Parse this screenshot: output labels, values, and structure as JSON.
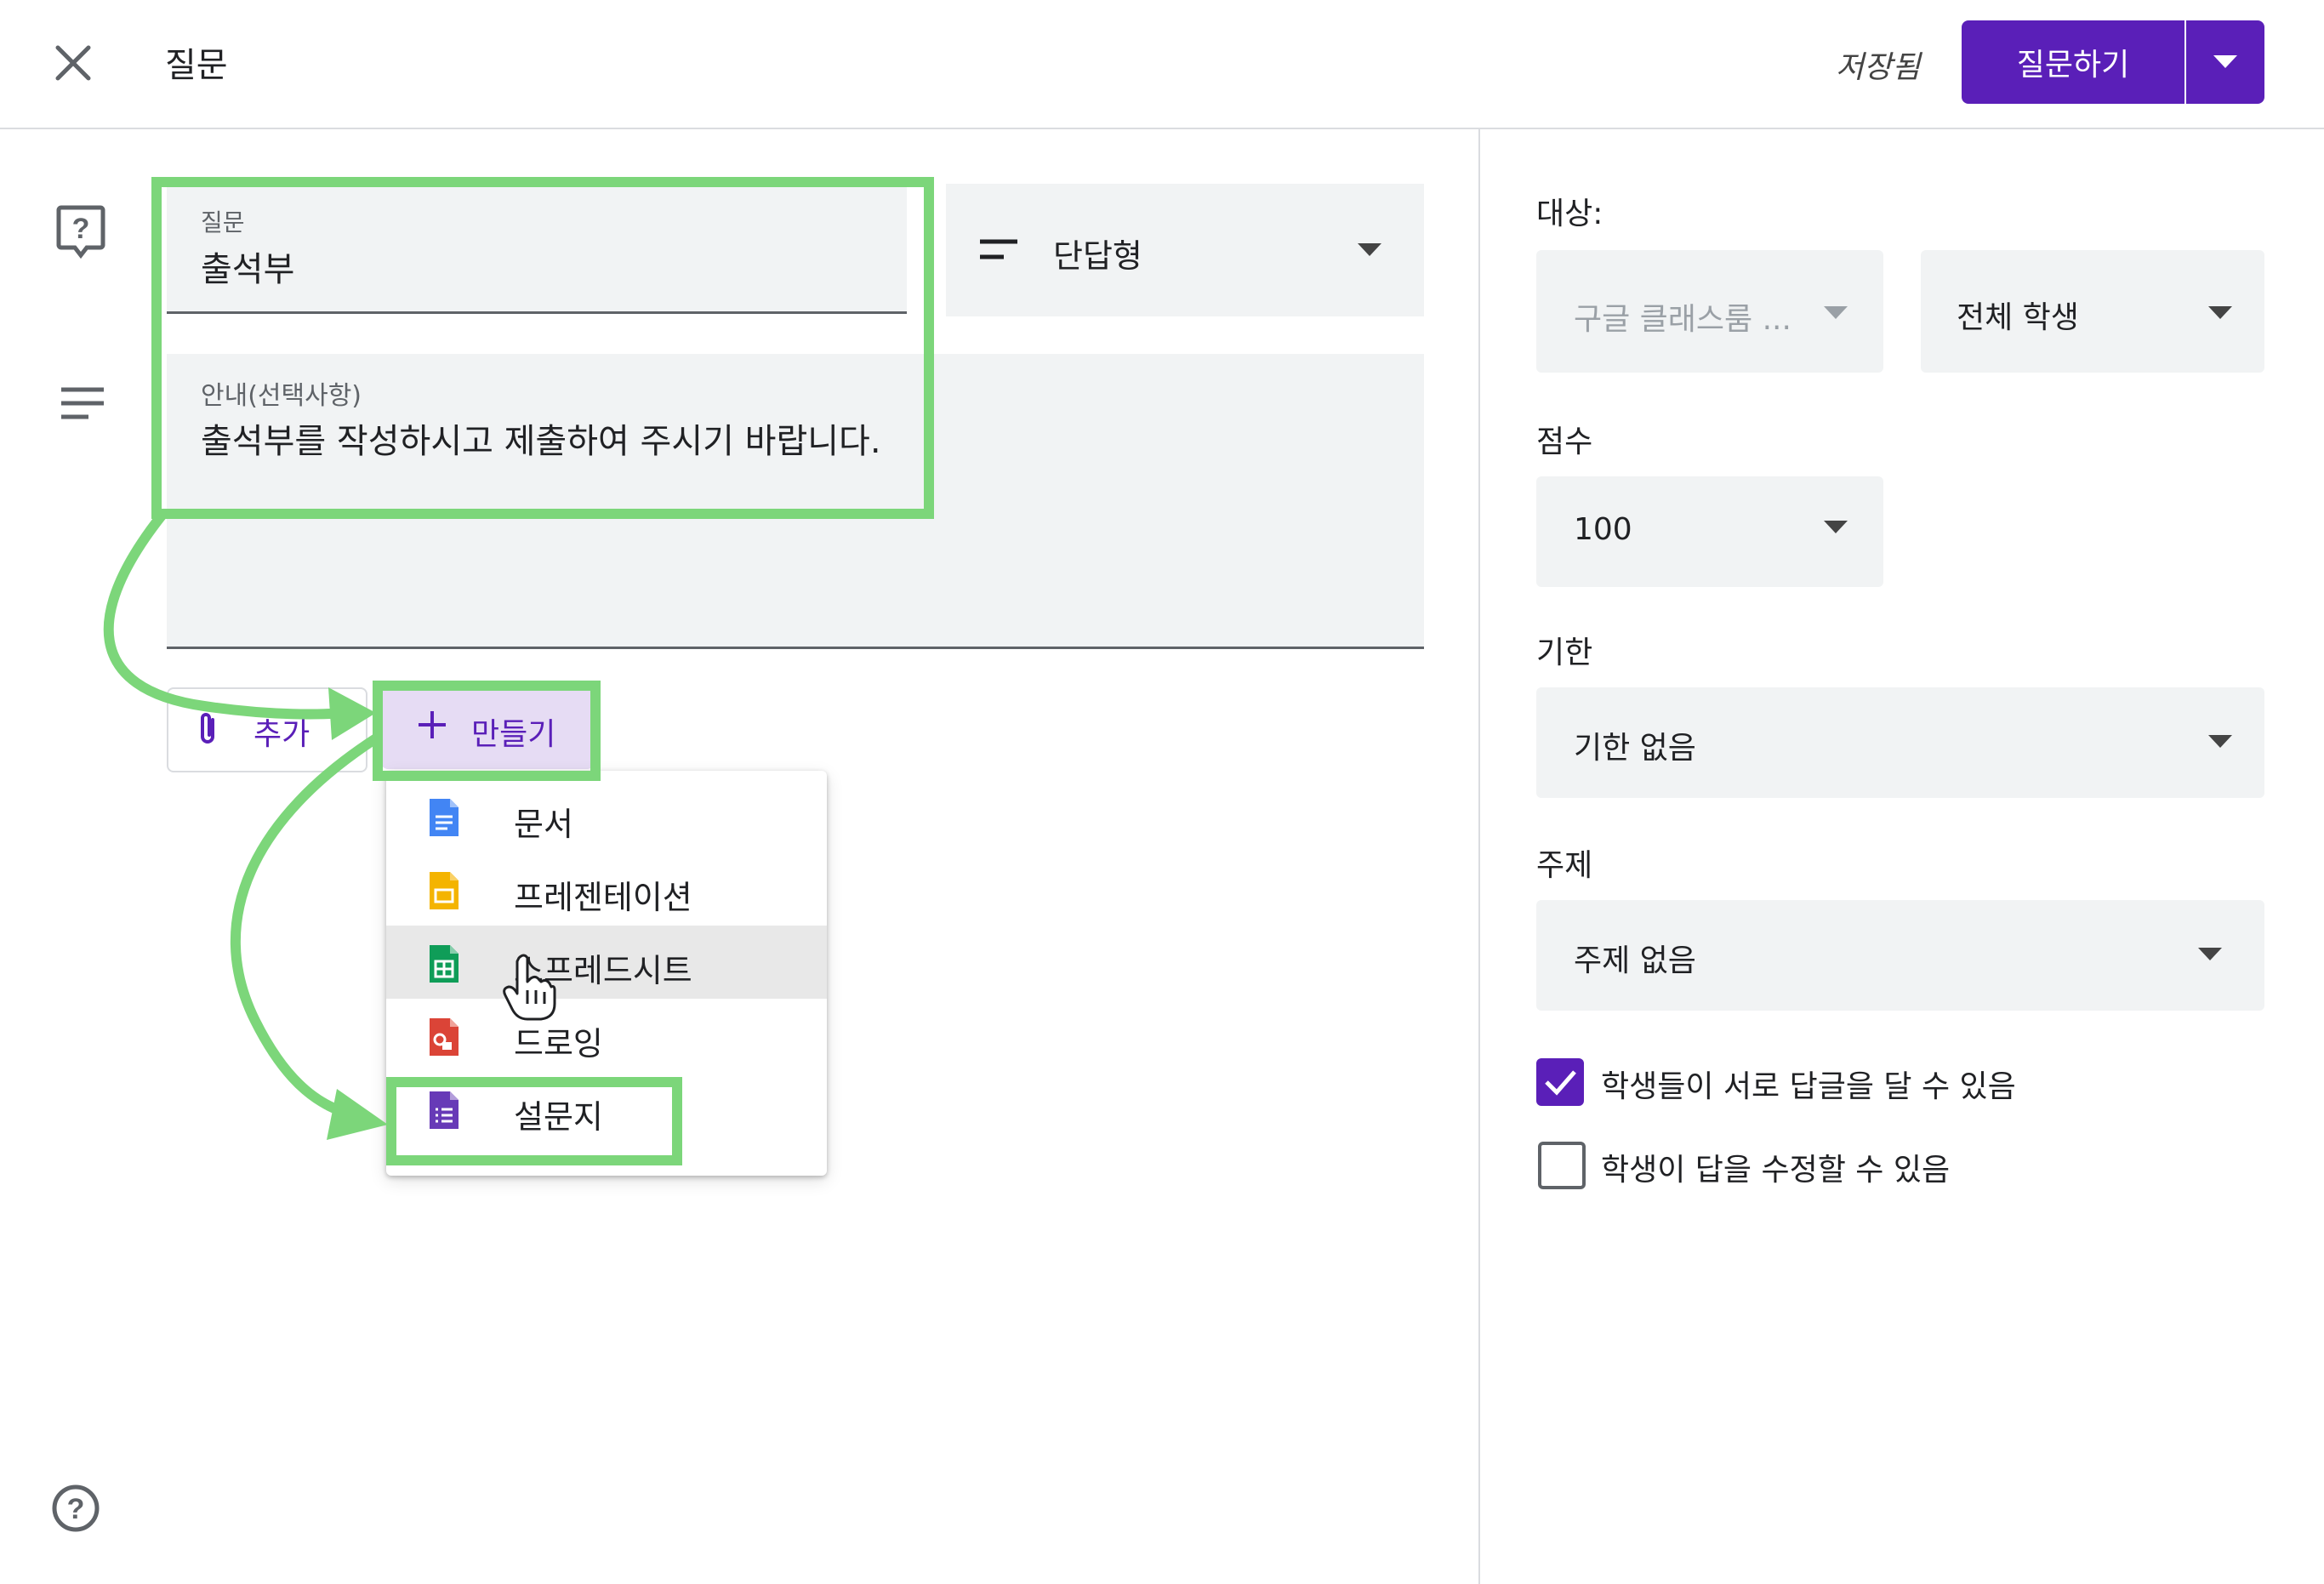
{
  "header": {
    "title": "질문",
    "status": "저장됨",
    "submit_label": "질문하기"
  },
  "question": {
    "label": "질문",
    "value": "출석부",
    "type_label": "단답형"
  },
  "description": {
    "label": "안내(선택사항)",
    "value": "출석부를 작성하시고 제출하여 주시기 바랍니다."
  },
  "attach": {
    "add_label": "추가",
    "create_label": "만들기"
  },
  "create_menu": {
    "items": [
      {
        "label": "문서",
        "icon": "docs-icon",
        "color": "#4285f4"
      },
      {
        "label": "프레젠테이션",
        "icon": "slides-icon",
        "color": "#f4b400"
      },
      {
        "label": "스프레드시트",
        "icon": "sheets-icon",
        "color": "#0f9d58"
      },
      {
        "label": "드로잉",
        "icon": "drawings-icon",
        "color": "#db4437"
      },
      {
        "label": "설문지",
        "icon": "forms-icon",
        "color": "#673ab7"
      }
    ],
    "hovered_index": 2
  },
  "settings": {
    "target_label": "대상:",
    "class_value": "구글 클래스룸 ...",
    "students_value": "전체 학생",
    "points_label": "점수",
    "points_value": "100",
    "due_label": "기한",
    "due_value": "기한 없음",
    "topic_label": "주제",
    "topic_value": "주제 없음",
    "reply_each_other": {
      "label": "학생들이 서로 답글을 달 수 있음",
      "checked": true
    },
    "edit_answer": {
      "label": "학생이 답을 수정할 수 있음",
      "checked": false
    }
  },
  "colors": {
    "accent": "#5a1fb8",
    "highlight": "#7cd67a"
  }
}
